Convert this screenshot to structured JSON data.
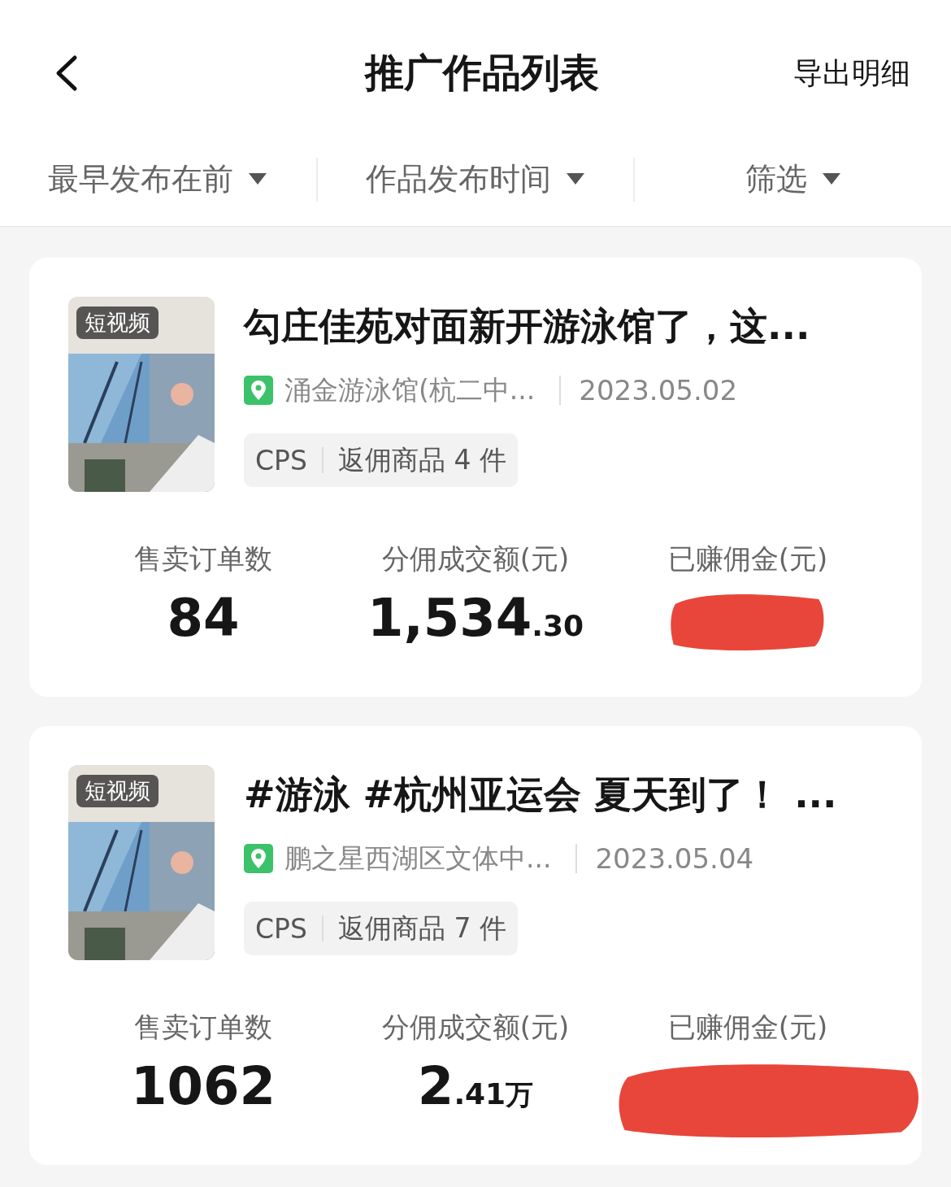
{
  "header": {
    "title": "推广作品列表",
    "action": "导出明细"
  },
  "filters": [
    {
      "label": "最早发布在前"
    },
    {
      "label": "作品发布时间"
    },
    {
      "label": "筛选"
    }
  ],
  "works": [
    {
      "badge": "短视频",
      "title": "勾庄佳苑对面新开游泳馆了，这...",
      "location": "涌金游泳馆(杭二中...",
      "date": "2023.05.02",
      "tag": "CPS",
      "goods": "返佣商品 4 件",
      "stats": [
        {
          "kind": "number",
          "label": "售卖订单数",
          "main": "84"
        },
        {
          "kind": "money",
          "label": "分佣成交额(元)",
          "main": "1,534",
          "small": ".30"
        },
        {
          "kind": "redacted",
          "label": "已赚佣金(元)"
        }
      ]
    },
    {
      "badge": "短视频",
      "title": "#游泳 #杭州亚运会 夏天到了！ ...",
      "location": "鹏之星西湖区文体中...",
      "date": "2023.05.04",
      "tag": "CPS",
      "goods": "返佣商品 7 件",
      "stats": [
        {
          "kind": "number",
          "label": "售卖订单数",
          "main": "1062"
        },
        {
          "kind": "money",
          "label": "分佣成交额(元)",
          "main": "2",
          "small": ".41",
          "unit": "万"
        },
        {
          "kind": "redacted",
          "label": "已赚佣金(元)"
        }
      ]
    }
  ]
}
